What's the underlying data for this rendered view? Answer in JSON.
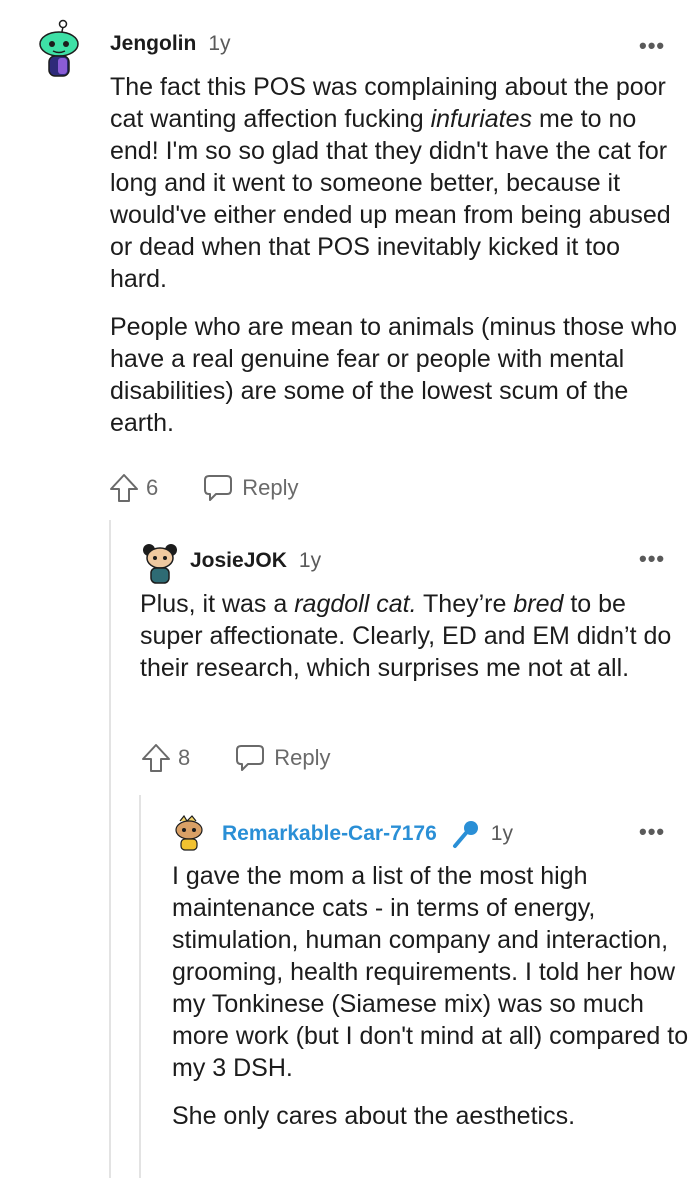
{
  "colors": {
    "op_username": "#2a8fd6",
    "thread_line": "#e3e3e3",
    "text": "#1c1c1c",
    "meta": "#5a5a5a"
  },
  "comments": [
    {
      "username": "Jengolin",
      "age": "1y",
      "more": "•••",
      "paragraphs": [
        {
          "before": "The fact this POS was complaining about the poor cat wanting affection fucking ",
          "em": "infuriates",
          "after": " me to no end! I'm so so glad that they didn't have the cat for long and it went to someone better, because it would've either ended up mean from being abused or dead when that POS inevitably kicked it too hard."
        },
        {
          "text": "People who are mean to animals (minus those who have a real genuine fear or people with mental disabilities) are some of the lowest scum of the earth."
        }
      ],
      "upvotes": "6",
      "reply_label": "Reply",
      "avatar_icon": "snoo-avatar-icon"
    },
    {
      "username": "JosieJOK",
      "age": "1y",
      "more": "•••",
      "paragraph": {
        "a": "Plus, it was a ",
        "em1": "ragdoll cat.",
        "b": " They’re ",
        "em2": "bred",
        "c": " to be super affectionate. Clearly, ED and EM didn’t do their research, which surprises me not at all."
      },
      "upvotes": "8",
      "reply_label": "Reply",
      "avatar_icon": "snoo-avatar-icon"
    },
    {
      "username": "Remarkable-Car-7176",
      "age": "1y",
      "more": "•••",
      "op_badge_icon": "microphone-icon",
      "paragraphs": [
        "I gave the mom a list of the most high maintenance cats - in terms of energy, stimulation, human company and interaction, grooming, health requirements. I told her how my Tonkinese (Siamese mix) was so much more work (but I don't mind at all) compared to my 3 DSH.",
        "She only cares about the aesthetics."
      ],
      "avatar_icon": "snoo-avatar-icon"
    }
  ]
}
